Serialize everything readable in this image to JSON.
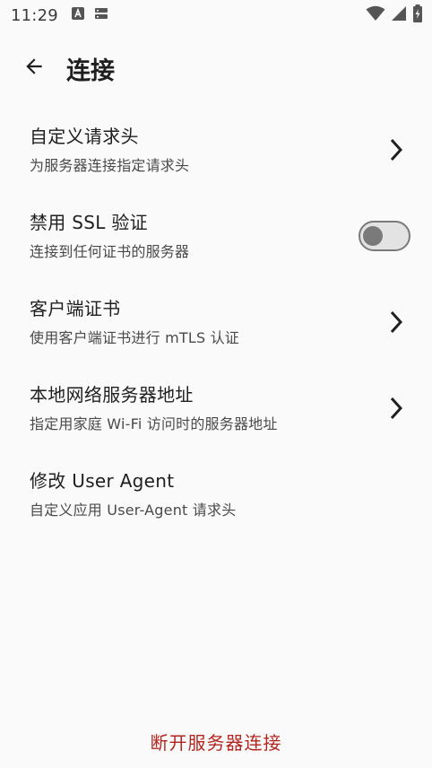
{
  "status_bar": {
    "time": "11:29",
    "left_icons": [
      "a-box-icon",
      "storage-icon"
    ],
    "right_icons": [
      "wifi-icon",
      "cellular-signal-icon",
      "battery-charging-icon"
    ]
  },
  "header": {
    "back_icon": "arrow-back-icon",
    "title": "连接"
  },
  "settings": [
    {
      "title": "自定义请求头",
      "subtitle": "为服务器连接指定请求头",
      "control": "chevron"
    },
    {
      "title": "禁用 SSL 验证",
      "subtitle": "连接到任何证书的服务器",
      "control": "toggle",
      "enabled": false
    },
    {
      "title": "客户端证书",
      "subtitle": "使用客户端证书进行 mTLS 认证",
      "control": "chevron"
    },
    {
      "title": "本地网络服务器地址",
      "subtitle": "指定用家庭 Wi-Fi 访问时的服务器地址",
      "control": "chevron"
    },
    {
      "title": "修改 User Agent",
      "subtitle": "自定义应用 User-Agent 请求头",
      "control": "none"
    }
  ],
  "footer": {
    "disconnect_label": "断开服务器连接"
  },
  "colors": {
    "background": "#fafafa",
    "danger": "#b3261e",
    "toggle_off": "#7a7a7a"
  }
}
